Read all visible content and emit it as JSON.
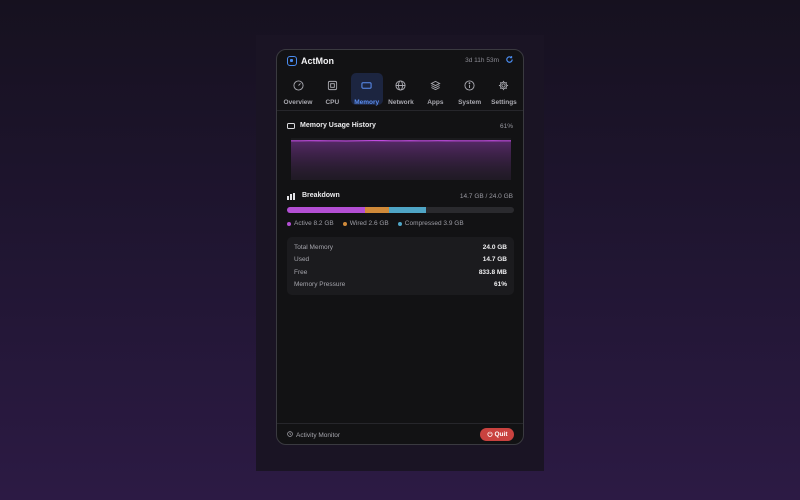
{
  "app": {
    "title": "ActMon",
    "uptime": "3d 11h 53m",
    "icon": "app-logo-icon",
    "refresh_icon": "refresh-icon"
  },
  "tabs": [
    {
      "label": "Overview",
      "icon": "gauge-icon",
      "active": false
    },
    {
      "label": "CPU",
      "icon": "cpu-icon",
      "active": false
    },
    {
      "label": "Memory",
      "icon": "memory-icon",
      "active": true
    },
    {
      "label": "Network",
      "icon": "globe-icon",
      "active": false
    },
    {
      "label": "Apps",
      "icon": "layers-icon",
      "active": false
    },
    {
      "label": "System",
      "icon": "info-icon",
      "active": false
    },
    {
      "label": "Settings",
      "icon": "gear-icon",
      "active": false
    }
  ],
  "history": {
    "title": "Memory Usage History",
    "value": "61%",
    "icon": "memory-icon",
    "line_color": "#c04be0",
    "points": [
      61,
      61,
      61.2,
      61.1,
      61,
      61,
      60.8,
      61,
      61.2,
      61.4,
      61.3,
      61,
      61,
      61.1,
      61,
      61,
      61.2,
      61.1,
      61,
      61,
      61,
      61,
      61.1,
      61,
      61
    ]
  },
  "breakdown": {
    "title": "Breakdown",
    "value": "14.7 GB / 24.0 GB",
    "icon": "bar-chart-icon",
    "total_gb": 24.0,
    "segments": [
      {
        "label": "Active 8.2 GB",
        "value": 8.2,
        "color": "#b34fd4"
      },
      {
        "label": "Wired 2.6 GB",
        "value": 2.6,
        "color": "#d08a3a"
      },
      {
        "label": "Compressed 3.9 GB",
        "value": 3.9,
        "color": "#4fa5c6"
      }
    ]
  },
  "stats": [
    {
      "label": "Total Memory",
      "value": "24.0 GB"
    },
    {
      "label": "Used",
      "value": "14.7 GB"
    },
    {
      "label": "Free",
      "value": "833.8 MB"
    },
    {
      "label": "Memory Pressure",
      "value": "61%"
    }
  ],
  "footer": {
    "link_label": "Activity Monitor",
    "link_icon": "activity-icon",
    "quit_label": "Quit",
    "quit_icon": "power-icon",
    "quit_color": "#c9423f"
  }
}
